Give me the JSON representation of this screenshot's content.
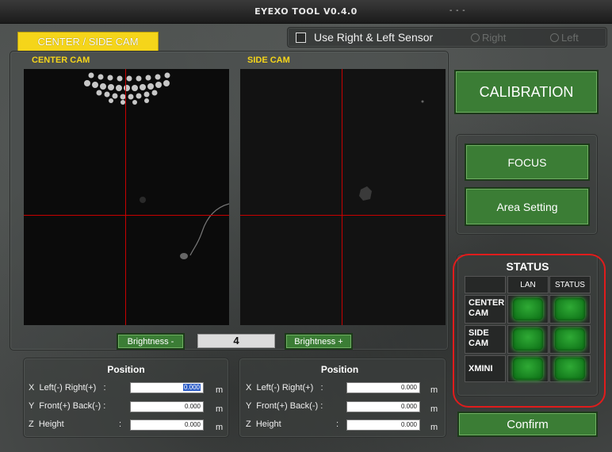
{
  "window": {
    "title": "EYEXO TOOL V0.4.0",
    "controls": "- - -"
  },
  "tab": {
    "label": "CENTER / SIDE CAM"
  },
  "sensor": {
    "checkbox_label": "Use Right & Left Sensor",
    "checked": false,
    "radio_right": "Right",
    "radio_left": "Left"
  },
  "cameras": {
    "center_label": "CENTER CAM",
    "side_label": "SIDE CAM"
  },
  "brightness": {
    "minus_label": "Brightness -",
    "value": "4",
    "plus_label": "Brightness +"
  },
  "buttons": {
    "calibration": "CALIBRATION",
    "focus": "FOCUS",
    "area_setting": "Area Setting",
    "confirm": "Confirm"
  },
  "status": {
    "title": "STATUS",
    "col_lan": "LAN",
    "col_status": "STATUS",
    "rows": [
      "CENTER CAM",
      "SIDE CAM",
      "XMINI"
    ],
    "led_color": "#22a02b"
  },
  "position_left": {
    "title": "Position",
    "x_label": "X  Left(-) Right(+)   :",
    "y_label": "Y  Front(+) Back(-) :",
    "z_label": "Z  Height",
    "z_colon": ":",
    "x_value": "0.000",
    "y_value": "0.000",
    "z_value": "0.000",
    "unit": "m"
  },
  "position_right": {
    "title": "Position",
    "x_label": "X  Left(-) Right(+)   :",
    "y_label": "Y  Front(+) Back(-) :",
    "z_label": "Z  Height",
    "z_colon": ":",
    "x_value": "0.000",
    "y_value": "0.000",
    "z_value": "0.000",
    "unit": "m"
  },
  "colors": {
    "accent_yellow": "#f5d51a",
    "button_green": "#3b7d35",
    "crosshair_red": "#c80000",
    "highlight_red": "#e01c1c"
  }
}
